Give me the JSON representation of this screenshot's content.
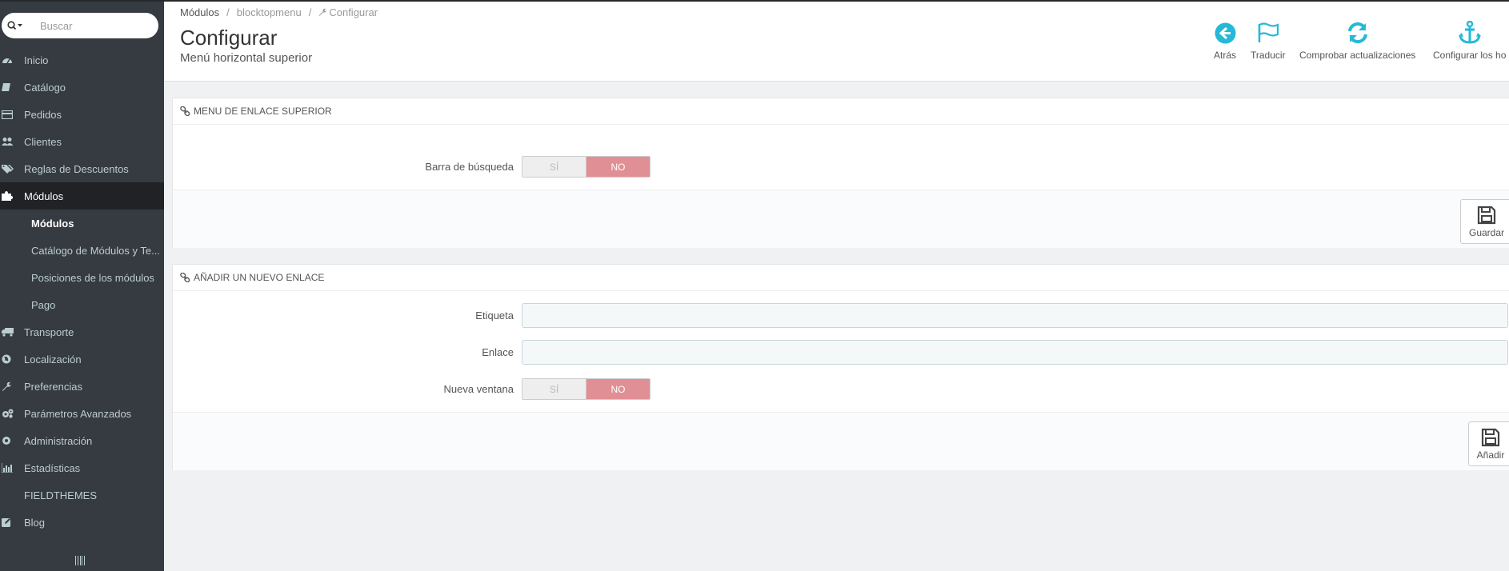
{
  "search": {
    "placeholder": "Buscar"
  },
  "sidebar": {
    "items": [
      {
        "label": "Inicio",
        "icon": "dashboard-icon"
      },
      {
        "label": "Catálogo",
        "icon": "book-icon"
      },
      {
        "label": "Pedidos",
        "icon": "credit-card-icon"
      },
      {
        "label": "Clientes",
        "icon": "users-icon"
      },
      {
        "label": "Reglas de Descuentos",
        "icon": "tags-icon"
      },
      {
        "label": "Módulos",
        "icon": "puzzle-icon",
        "active": true
      },
      {
        "label": "Transporte",
        "icon": "truck-icon"
      },
      {
        "label": "Localización",
        "icon": "globe-icon"
      },
      {
        "label": "Preferencias",
        "icon": "wrench-icon"
      },
      {
        "label": "Parámetros Avanzados",
        "icon": "cogs-icon"
      },
      {
        "label": "Administración",
        "icon": "cog-icon"
      },
      {
        "label": "Estadísticas",
        "icon": "bar-chart-icon"
      },
      {
        "label": "FIELDTHEMES",
        "icon": ""
      },
      {
        "label": "Blog",
        "icon": "edit-icon"
      }
    ],
    "submenu": [
      {
        "label": "Módulos",
        "active": true
      },
      {
        "label": "Catálogo de Módulos y Te..."
      },
      {
        "label": "Posiciones de los módulos"
      },
      {
        "label": "Pago"
      }
    ]
  },
  "breadcrumb": {
    "first": "Módulos",
    "sep": "/",
    "second": "blocktopmenu",
    "current": "Configurar"
  },
  "page": {
    "title": "Configurar",
    "subtitle": "Menú horizontal superior"
  },
  "toolbar": {
    "back": "Atrás",
    "translate": "Traducir",
    "check_updates": "Comprobar actualizaciones",
    "hooks": "Configurar los ho"
  },
  "panel1": {
    "title": "MENU DE ENLACE SUPERIOR",
    "search_bar_label": "Barra de búsqueda",
    "yes": "SÍ",
    "no": "NO",
    "save": "Guardar"
  },
  "panel2": {
    "title": "AÑADIR UN NUEVO ENLACE",
    "label_field": "Etiqueta",
    "link_field": "Enlace",
    "new_window_label": "Nueva ventana",
    "yes": "SÍ",
    "no": "NO",
    "add": "Añadir"
  },
  "colors": {
    "accent": "#25b9d7",
    "sidebar": "#363a41",
    "switch_no": "#e08f95"
  }
}
